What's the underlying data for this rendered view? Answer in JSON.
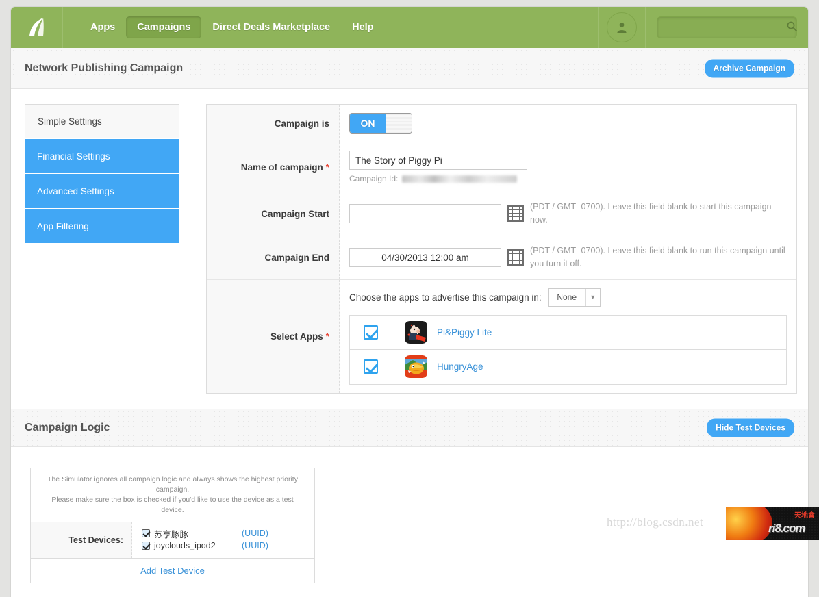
{
  "topnav": {
    "logo_name": "fiksu-leaf-logo",
    "links": [
      {
        "label": "Apps",
        "active": false
      },
      {
        "label": "Campaigns",
        "active": true
      },
      {
        "label": "Direct Deals Marketplace",
        "active": false
      },
      {
        "label": "Help",
        "active": false
      }
    ],
    "search_placeholder": "",
    "search_value": "",
    "accent_green": "#8fb45a"
  },
  "page_header": {
    "title": "Network Publishing Campaign",
    "archive_button": "Archive Campaign"
  },
  "settings_nav": {
    "items": [
      {
        "label": "Simple Settings",
        "state": "active"
      },
      {
        "label": "Financial Settings",
        "state": "blue"
      },
      {
        "label": "Advanced Settings",
        "state": "blue"
      },
      {
        "label": "App Filtering",
        "state": "blue"
      }
    ]
  },
  "form": {
    "campaign_is": {
      "label": "Campaign is",
      "toggle_on_label": "ON",
      "value": "ON"
    },
    "name_of_campaign": {
      "label": "Name of campaign",
      "required": "*",
      "value": "The Story of Piggy Pi",
      "placeholder": "",
      "campaign_id_label": "Campaign Id:",
      "campaign_id_value": ""
    },
    "campaign_start": {
      "label": "Campaign Start",
      "value": "",
      "placeholder": "",
      "helper": "(PDT / GMT -0700). Leave this field blank to start this campaign now."
    },
    "campaign_end": {
      "label": "Campaign End",
      "value": "04/30/2013 12:00 am",
      "placeholder": "",
      "helper": "(PDT / GMT -0700). Leave this field blank to run this campaign until you turn it off."
    },
    "select_apps": {
      "label": "Select Apps",
      "required": "*",
      "choose_text": "Choose the apps to advertise this campaign in:",
      "select_value": "None",
      "apps": [
        {
          "name": "Pi&Piggy Lite",
          "checked": true
        },
        {
          "name": "HungryAge",
          "checked": true
        }
      ]
    }
  },
  "campaign_logic": {
    "title": "Campaign Logic",
    "hide_button": "Hide Test Devices",
    "note_line1": "The Simulator ignores all campaign logic and always shows the highest priority campaign.",
    "note_line2": "Please make sure the box is checked if you'd like to use the device as a test device.",
    "test_devices_label": "Test Devices:",
    "devices": [
      {
        "name": "苏亨豚豚",
        "uuid_label": "(UUID)",
        "checked": true
      },
      {
        "name": "joyclouds_ipod2",
        "uuid_label": "(UUID)",
        "checked": true
      }
    ],
    "add_device_label": "Add Test Device"
  },
  "overlay": {
    "watermark": "http://blog.csdn.net",
    "ad_text": "ri8.com",
    "ad_cn_text": "天地會"
  }
}
